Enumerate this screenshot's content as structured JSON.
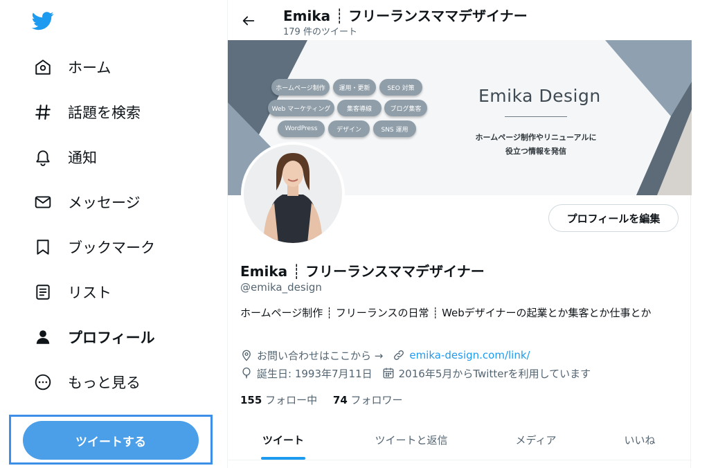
{
  "sidebar": {
    "logo": "twitter-bird-icon",
    "items": [
      {
        "label": "ホーム",
        "icon": "home-icon"
      },
      {
        "label": "話題を検索",
        "icon": "hashtag-icon"
      },
      {
        "label": "通知",
        "icon": "bell-icon"
      },
      {
        "label": "メッセージ",
        "icon": "envelope-icon"
      },
      {
        "label": "ブックマーク",
        "icon": "bookmark-icon"
      },
      {
        "label": "リスト",
        "icon": "list-icon"
      },
      {
        "label": "プロフィール",
        "icon": "person-icon",
        "active": true
      },
      {
        "label": "もっと見る",
        "icon": "more-circle-icon"
      }
    ],
    "tweet_button": "ツイートする"
  },
  "header": {
    "title": "Emika ┊ フリーランスママデザイナー",
    "subtitle": "179 件のツイート"
  },
  "banner": {
    "pills": [
      "ホームページ制作",
      "運用・更新",
      "SEO 対策",
      "Web マーケティング",
      "集客導線",
      "ブログ集客",
      "WordPress",
      "デザイン",
      "SNS 運用"
    ],
    "brand_name": "Emika Design",
    "tagline_1": "ホームページ制作やリニューアルに",
    "tagline_2": "役立つ情報を発信"
  },
  "profile": {
    "edit_button": "プロフィールを編集",
    "name": "Emika ┊ フリーランスママデザイナー",
    "handle": "@emika_design",
    "bio": "ホームページ制作 ┊ フリーランスの日常 ┊ Webデザイナーの起業とか集客とか仕事とか",
    "location": "お問い合わせはここから →",
    "link": "emika-design.com/link/",
    "birthday": "誕生日: 1993年7月11日",
    "joined": "2016年5月からTwitterを利用しています",
    "following_count": "155",
    "following_label": "フォロー中",
    "followers_count": "74",
    "followers_label": "フォロワー"
  },
  "tabs": [
    {
      "label": "ツイート",
      "active": true
    },
    {
      "label": "ツイートと返信"
    },
    {
      "label": "メディア"
    },
    {
      "label": "いいね"
    }
  ],
  "colors": {
    "accent": "#1d9bf0",
    "tweet_button": "#4b9fe8",
    "highlight_frame": "#3d8ee6",
    "banner_slate": "#5f6f7e",
    "banner_light": "#8fa1b0"
  }
}
